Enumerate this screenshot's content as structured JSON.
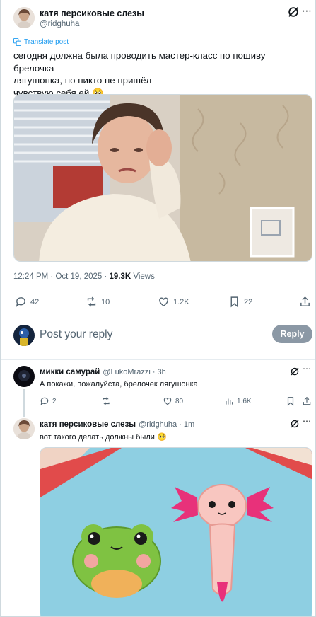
{
  "post": {
    "author_name": "катя персиковые слезы",
    "author_handle": "@ridghuha",
    "translate_label": "Translate post",
    "text_line1": "сегодня должна была проводить мастер-класс по пошиву брелочка",
    "text_line2": "лягушонка, но никто не пришёл",
    "text_line3": "чувствую себя ей 🥺",
    "time": "12:24 PM · Oct 19, 2025 · ",
    "views_count": "19.3K",
    "views_label": " Views",
    "replies": "42",
    "reposts": "10",
    "likes": "1.2K",
    "bookmarks": "22"
  },
  "reply_box": {
    "placeholder": "Post your reply",
    "button": "Reply"
  },
  "replies": [
    {
      "name": "микки самурай",
      "handle": "@LukoMrazzi · 3h",
      "text": "А покажи, пожалуйста, брелочек лягушонка",
      "replies": "2",
      "reposts": "",
      "likes": "80",
      "views": "1.6K"
    },
    {
      "name": "катя персиковые слезы",
      "handle": "@ridghuha · 1m",
      "text": "вот такого делать должны были 🥺"
    }
  ],
  "colors": {
    "accent": "#1d9bf0",
    "muted": "#536471",
    "reply_button": "#8b98a5"
  }
}
